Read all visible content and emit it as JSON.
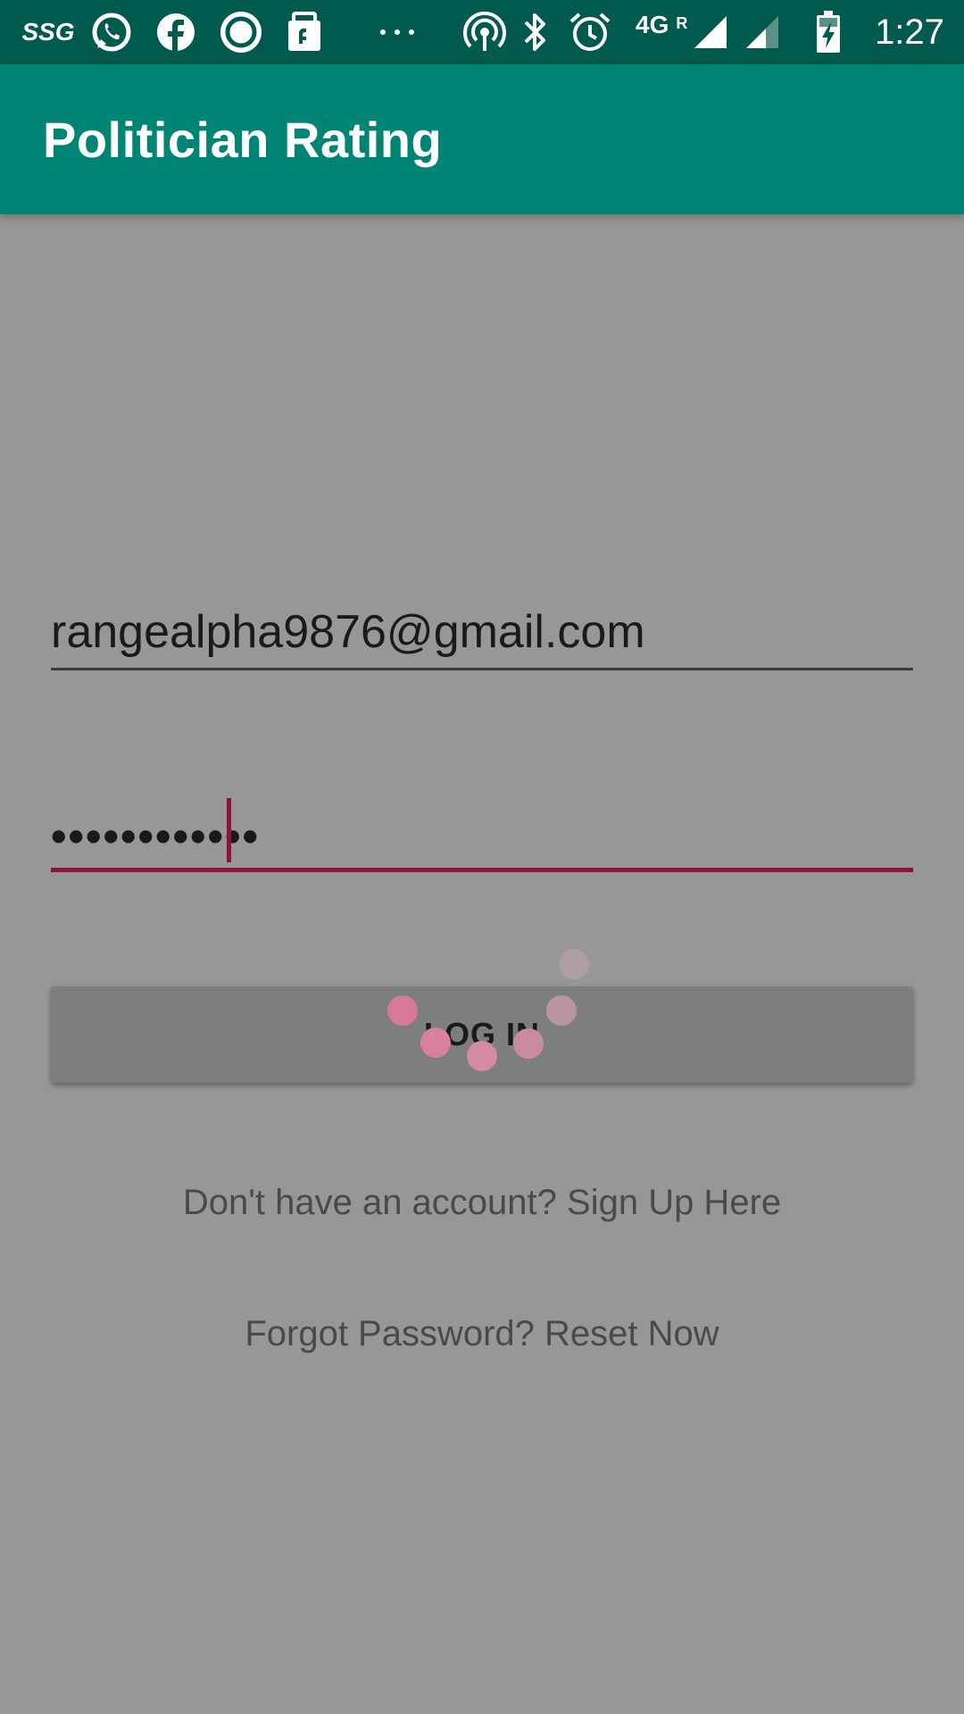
{
  "status_bar": {
    "carrier_logo": "SSG",
    "network": "4G",
    "roaming": "R",
    "time": "1:27",
    "icons": [
      "ssg-icon",
      "whatsapp-icon",
      "facebook-icon",
      "circle-app-icon",
      "shopping-bag-icon",
      "more-dots-icon",
      "hotspot-icon",
      "bluetooth-icon",
      "alarm-icon",
      "signal-icon",
      "signal-icon-2",
      "battery-charging-icon"
    ]
  },
  "app_bar": {
    "title": "Politician Rating",
    "color": "#008473"
  },
  "login_form": {
    "email_value": "rangealpha9876@gmail.com",
    "password_value": "••••••••••••",
    "accent_color": "#8a1538",
    "login_button_label": "LOG IN"
  },
  "links": {
    "signup": "Don't have an account? Sign Up Here",
    "reset": "Forgot Password? Reset Now"
  },
  "loading_indicator": {
    "visible": true,
    "color": "#d9799a"
  }
}
